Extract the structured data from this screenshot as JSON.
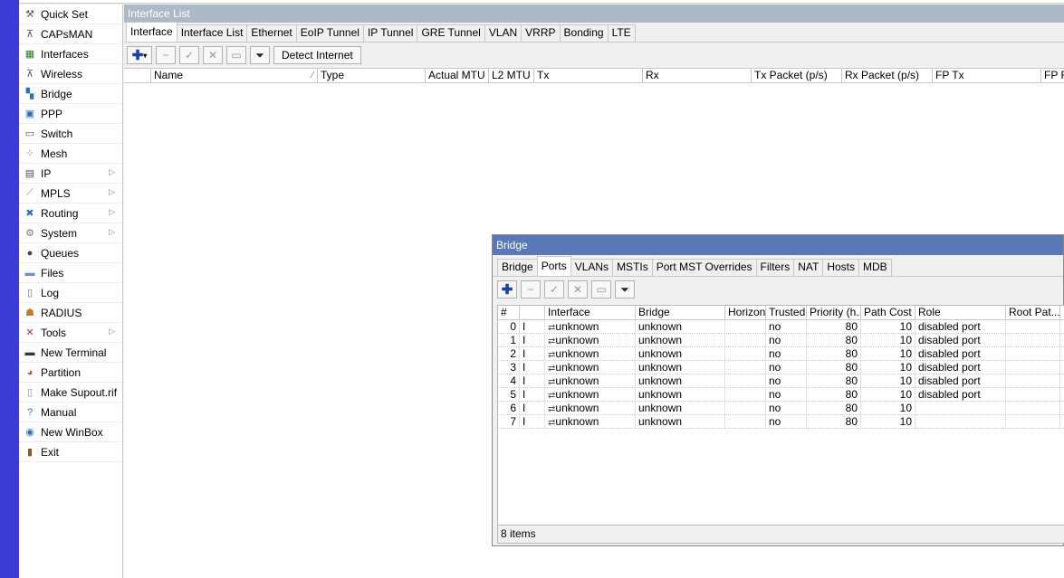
{
  "sidebar": {
    "items": [
      {
        "label": "Quick Set",
        "icon": "quickset-icon",
        "glyph": "⚒",
        "color": "#555",
        "arrow": false
      },
      {
        "label": "CAPsMAN",
        "icon": "capsman-icon",
        "glyph": "⊼",
        "color": "#555",
        "arrow": false
      },
      {
        "label": "Interfaces",
        "icon": "interfaces-icon",
        "glyph": "▦",
        "color": "#2a7a2a",
        "arrow": false
      },
      {
        "label": "Wireless",
        "icon": "wireless-icon",
        "glyph": "⊼",
        "color": "#555",
        "arrow": false
      },
      {
        "label": "Bridge",
        "icon": "bridge-icon",
        "glyph": "▚",
        "color": "#2f6fb5",
        "arrow": false
      },
      {
        "label": "PPP",
        "icon": "ppp-icon",
        "glyph": "▣",
        "color": "#2f6fb5",
        "arrow": false
      },
      {
        "label": "Switch",
        "icon": "switch-icon",
        "glyph": "▭",
        "color": "#555",
        "arrow": false
      },
      {
        "label": "Mesh",
        "icon": "mesh-icon",
        "glyph": "⁘",
        "color": "#2f6fb5",
        "arrow": false
      },
      {
        "label": "IP",
        "icon": "ip-icon",
        "glyph": "▤",
        "color": "#555",
        "arrow": true
      },
      {
        "label": "MPLS",
        "icon": "mpls-icon",
        "glyph": "⟋",
        "color": "#888",
        "arrow": true
      },
      {
        "label": "Routing",
        "icon": "routing-icon",
        "glyph": "✖",
        "color": "#2f6fb5",
        "arrow": true
      },
      {
        "label": "System",
        "icon": "system-icon",
        "glyph": "⚙",
        "color": "#777",
        "arrow": true
      },
      {
        "label": "Queues",
        "icon": "queues-icon",
        "glyph": "●",
        "color": "#444",
        "arrow": false
      },
      {
        "label": "Files",
        "icon": "files-icon",
        "glyph": "▬",
        "color": "#6b8fc2",
        "arrow": false
      },
      {
        "label": "Log",
        "icon": "log-icon",
        "glyph": "▯",
        "color": "#777",
        "arrow": false
      },
      {
        "label": "RADIUS",
        "icon": "radius-icon",
        "glyph": "☗",
        "color": "#c47a2a",
        "arrow": false
      },
      {
        "label": "Tools",
        "icon": "tools-icon",
        "glyph": "✕",
        "color": "#b03030",
        "arrow": true
      },
      {
        "label": "New Terminal",
        "icon": "terminal-icon",
        "glyph": "▬",
        "color": "#333",
        "arrow": false
      },
      {
        "label": "Partition",
        "icon": "partition-icon",
        "glyph": "◕",
        "color": "#d04a20",
        "arrow": false
      },
      {
        "label": "Make Supout.rif",
        "icon": "supout-icon",
        "glyph": "▯",
        "color": "#6b8fc2",
        "arrow": false
      },
      {
        "label": "Manual",
        "icon": "manual-icon",
        "glyph": "?",
        "color": "#2f6fb5",
        "arrow": false
      },
      {
        "label": "New WinBox",
        "icon": "winbox-icon",
        "glyph": "◉",
        "color": "#2f6fb5",
        "arrow": false
      },
      {
        "label": "Exit",
        "icon": "exit-icon",
        "glyph": "▮",
        "color": "#8a5a2a",
        "arrow": false
      }
    ]
  },
  "interface_window": {
    "title": "Interface List",
    "tabs": [
      "Interface",
      "Interface List",
      "Ethernet",
      "EoIP Tunnel",
      "IP Tunnel",
      "GRE Tunnel",
      "VLAN",
      "VRRP",
      "Bonding",
      "LTE"
    ],
    "active_tab": "Interface",
    "detect_label": "Detect Internet",
    "columns": [
      "Name",
      "Type",
      "Actual MTU",
      "L2 MTU",
      "Tx",
      "Rx",
      "Tx Packet (p/s)",
      "Rx Packet (p/s)",
      "FP Tx",
      "FP R"
    ]
  },
  "bridge_window": {
    "title": "Bridge",
    "tabs": [
      "Bridge",
      "Ports",
      "VLANs",
      "MSTIs",
      "Port MST Overrides",
      "Filters",
      "NAT",
      "Hosts",
      "MDB"
    ],
    "active_tab": "Ports",
    "columns": [
      "#",
      "",
      "Interface",
      "Bridge",
      "Horizon",
      "Trusted",
      "Priority (h...",
      "Path Cost",
      "Role",
      "Root Pat..."
    ],
    "rows": [
      {
        "num": "0",
        "flag": "I",
        "interface": "unknown",
        "bridge": "unknown",
        "horizon": "",
        "trusted": "no",
        "priority": "80",
        "path_cost": "10",
        "role": "disabled port",
        "root_path": ""
      },
      {
        "num": "1",
        "flag": "I",
        "interface": "unknown",
        "bridge": "unknown",
        "horizon": "",
        "trusted": "no",
        "priority": "80",
        "path_cost": "10",
        "role": "disabled port",
        "root_path": ""
      },
      {
        "num": "2",
        "flag": "I",
        "interface": "unknown",
        "bridge": "unknown",
        "horizon": "",
        "trusted": "no",
        "priority": "80",
        "path_cost": "10",
        "role": "disabled port",
        "root_path": ""
      },
      {
        "num": "3",
        "flag": "I",
        "interface": "unknown",
        "bridge": "unknown",
        "horizon": "",
        "trusted": "no",
        "priority": "80",
        "path_cost": "10",
        "role": "disabled port",
        "root_path": ""
      },
      {
        "num": "4",
        "flag": "I",
        "interface": "unknown",
        "bridge": "unknown",
        "horizon": "",
        "trusted": "no",
        "priority": "80",
        "path_cost": "10",
        "role": "disabled port",
        "root_path": ""
      },
      {
        "num": "5",
        "flag": "I",
        "interface": "unknown",
        "bridge": "unknown",
        "horizon": "",
        "trusted": "no",
        "priority": "80",
        "path_cost": "10",
        "role": "disabled port",
        "root_path": ""
      },
      {
        "num": "6",
        "flag": "I",
        "interface": "unknown",
        "bridge": "unknown",
        "horizon": "",
        "trusted": "no",
        "priority": "80",
        "path_cost": "10",
        "role": "",
        "root_path": ""
      },
      {
        "num": "7",
        "flag": "I",
        "interface": "unknown",
        "bridge": "unknown",
        "horizon": "",
        "trusted": "no",
        "priority": "80",
        "path_cost": "10",
        "role": "",
        "root_path": ""
      }
    ],
    "status": "8 items"
  }
}
